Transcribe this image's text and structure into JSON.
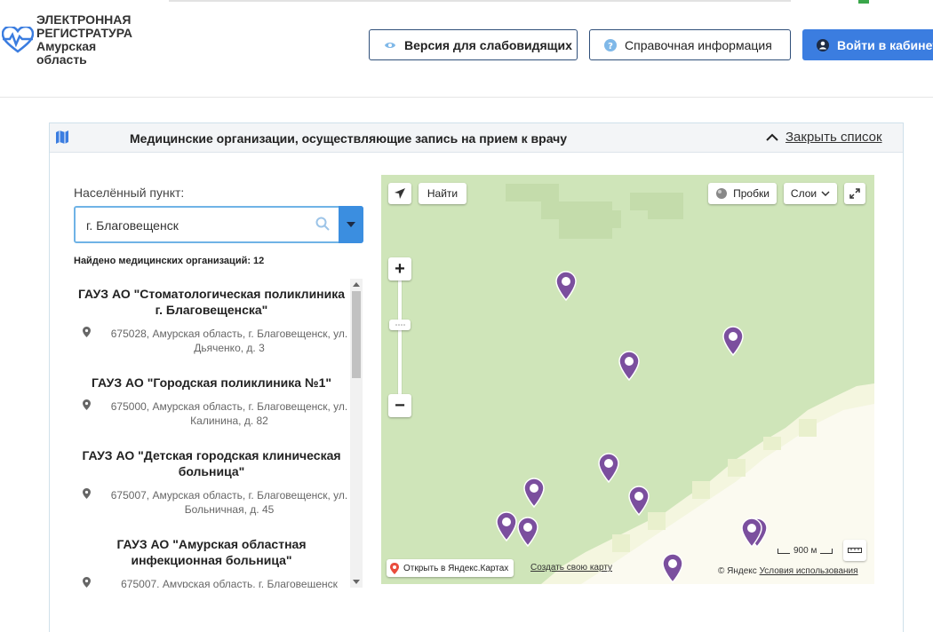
{
  "header": {
    "logo_line1": "ЭЛЕКТРОННАЯ",
    "logo_line2": "РЕГИСТРАТУРА",
    "logo_line3": "Амурская",
    "logo_line4": "область",
    "vision_label": "Версия для слабовидящих",
    "info_label": "Справочная информация",
    "login_label": "Войти в кабинет"
  },
  "panel": {
    "title": "Медицинские организации, осуществляющие запись на прием к врачу",
    "close_label": "Закрыть список",
    "city_label": "Населённый пункт:",
    "city_value": "г. Благовещенск",
    "found_text": "Найдено медицинских организаций: 12",
    "orgs": [
      {
        "name": "ГАУЗ АО \"Стоматологическая поликлиника г. Благовещенска\"",
        "address": "675028, Амурская область, г. Благовещенск, ул. Дьяченко, д. 3"
      },
      {
        "name": "ГАУЗ АО \"Городская поликлиника №1\"",
        "address": "675000, Амурская область, г. Благовещенск, ул. Калинина, д. 82"
      },
      {
        "name": "ГАУЗ АО \"Детская городская клиническая больница\"",
        "address": "675007, Амурская область, г. Благовещенск, ул. Больничная, д. 45"
      },
      {
        "name": "ГАУЗ АО \"Амурская областная инфекционная больница\"",
        "address": "675007, Амурская область, г. Благовещенск"
      }
    ]
  },
  "map": {
    "find_label": "Найти",
    "traffic_label": "Пробки",
    "layers_label": "Слои",
    "open_label": "Открыть в Яндекс.Картах",
    "create_label": "Создать свою карту",
    "copyright": "© Яндекс",
    "terms": "Условия использования",
    "scale_label": "900 м",
    "marker_color": "#7b4f9e",
    "land_color": "#cfe5b9",
    "river_color": "#fbfaf0"
  }
}
